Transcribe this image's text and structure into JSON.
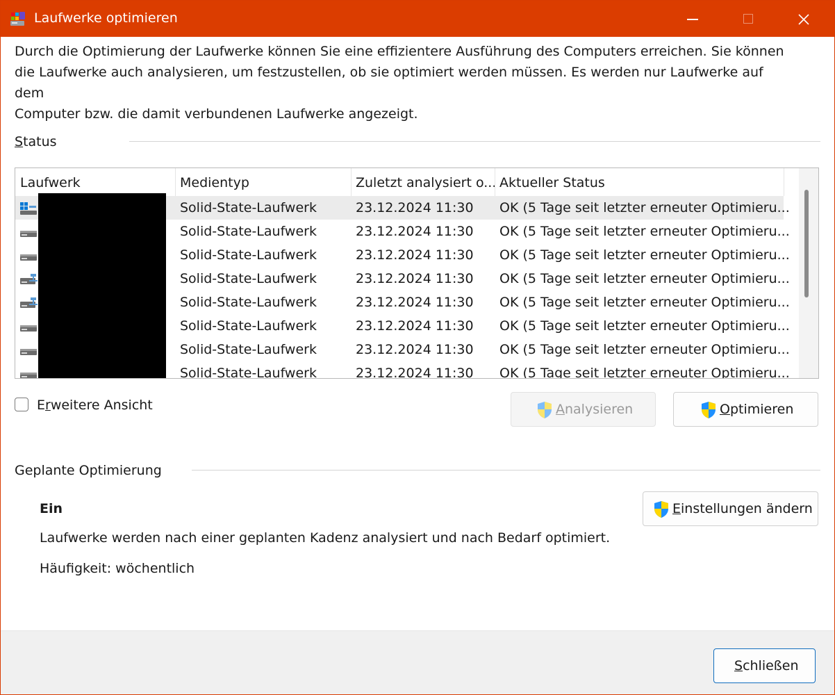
{
  "window": {
    "title": "Laufwerke optimieren",
    "accent_color": "#db3d00"
  },
  "intro": {
    "line1": "Durch die Optimierung der Laufwerke können Sie eine effizientere Ausführung des Computers erreichen. Sie können",
    "line2": "die Laufwerke auch analysieren, um festzustellen, ob sie optimiert werden müssen. Es werden nur Laufwerke auf dem",
    "line3": "Computer bzw. die damit verbundenen Laufwerke angezeigt."
  },
  "status_section": {
    "label_underlined_char": "S",
    "label_rest": "tatus"
  },
  "drive_list": {
    "columns": [
      "Laufwerk",
      "Medientyp",
      "Zuletzt analysiert o...",
      "Aktueller Status"
    ],
    "rows": [
      {
        "icon": "windows-drive-icon",
        "media": "Solid-State-Laufwerk",
        "last": "23.12.2024 11:30",
        "status": "OK (5 Tage seit letzter erneuter Optimieru..."
      },
      {
        "icon": "drive-icon",
        "media": "Solid-State-Laufwerk",
        "last": "23.12.2024 11:30",
        "status": "OK (5 Tage seit letzter erneuter Optimieru..."
      },
      {
        "icon": "drive-icon",
        "media": "Solid-State-Laufwerk",
        "last": "23.12.2024 11:30",
        "status": "OK (5 Tage seit letzter erneuter Optimieru..."
      },
      {
        "icon": "network-drive-icon",
        "media": "Solid-State-Laufwerk",
        "last": "23.12.2024 11:30",
        "status": "OK (5 Tage seit letzter erneuter Optimieru..."
      },
      {
        "icon": "network-drive-icon",
        "media": "Solid-State-Laufwerk",
        "last": "23.12.2024 11:30",
        "status": "OK (5 Tage seit letzter erneuter Optimieru..."
      },
      {
        "icon": "drive-icon",
        "media": "Solid-State-Laufwerk",
        "last": "23.12.2024 11:30",
        "status": "OK (5 Tage seit letzter erneuter Optimieru..."
      },
      {
        "icon": "drive-icon",
        "media": "Solid-State-Laufwerk",
        "last": "23.12.2024 11:30",
        "status": "OK (5 Tage seit letzter erneuter Optimieru..."
      },
      {
        "icon": "drive-icon",
        "media": "Solid-State-Laufwerk",
        "last": "23.12.2024 11:30",
        "status": "OK (5 Tage seit letzter erneuter Optimieru..."
      }
    ]
  },
  "advanced_view": {
    "label_first": "E",
    "label_underlined_char": "r",
    "label_rest": "weitere Ansicht",
    "checked": false
  },
  "buttons": {
    "analyze_u": "A",
    "analyze_rest": "nalysieren",
    "optimize_u": "O",
    "optimize_rest": "ptimieren",
    "change_u": "E",
    "change_rest": "instellungen ändern",
    "close_u": "S",
    "close_rest": "chließen"
  },
  "scheduled": {
    "label": "Geplante Optimierung",
    "state": "Ein",
    "description": "Laufwerke werden nach einer geplanten Kadenz analysiert und nach Bedarf optimiert.",
    "frequency": "Häufigkeit: wöchentlich"
  }
}
